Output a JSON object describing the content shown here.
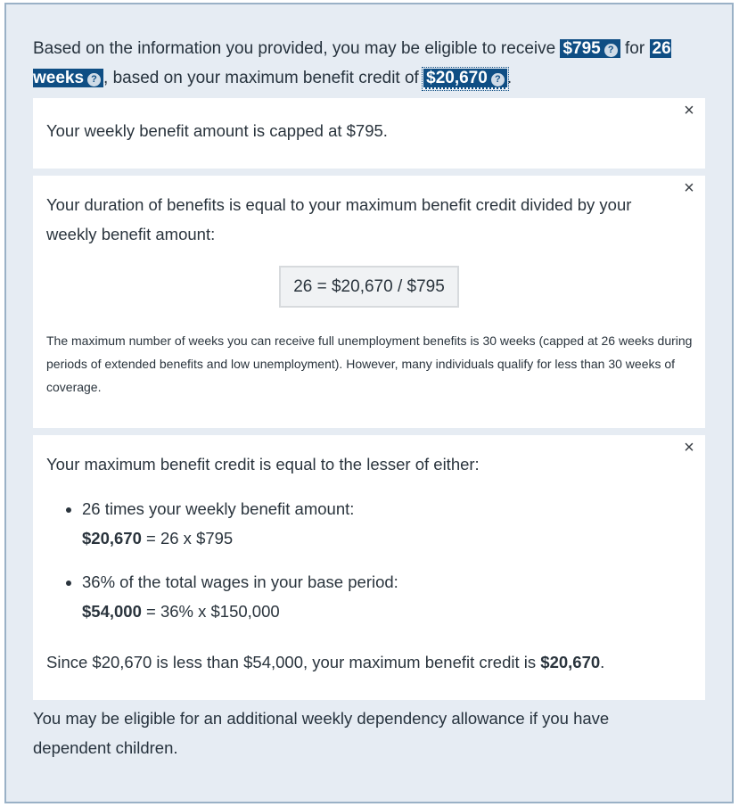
{
  "intro": {
    "prefix": "Based on the information you provided, you may be eligible to receive",
    "amount": "$795",
    "mid": "for",
    "duration": "26 weeks",
    "mid2": ", based on your maximum benefit credit of",
    "credit": "$20,670",
    "suffix": ".",
    "help_glyph": "?"
  },
  "card1": {
    "text": "Your weekly benefit amount is capped at $795.",
    "close_glyph": "×"
  },
  "card2": {
    "text": "Your duration of benefits is equal to your maximum benefit credit divided by your weekly benefit amount:",
    "formula": "26 = $20,670 / $795",
    "note": "The maximum number of weeks you can receive full unemployment benefits is 30 weeks (capped at 26 weeks during periods of extended benefits and low unemployment). However, many individuals qualify for less than 30 weeks of coverage.",
    "close_glyph": "×"
  },
  "card3": {
    "heading": "Your maximum benefit credit is equal to the lesser of either:",
    "items": [
      {
        "label": "26 times your weekly benefit amount:",
        "result": "$20,670",
        "expr": " = 26 x $795"
      },
      {
        "label": "36% of the total wages in your base period:",
        "result": "$54,000",
        "expr": " = 36% x $150,000"
      }
    ],
    "conclusion_prefix": "Since $20,670 is less than $54,000, your maximum benefit credit is",
    "conclusion_value": "$20,670",
    "conclusion_suffix": ".",
    "close_glyph": "×"
  },
  "footer": {
    "text": "You may be eligible for an additional weekly dependency allowance if you have dependent children."
  },
  "colors": {
    "panel_bg": "#e6ecf3",
    "panel_border": "#9ab1c6",
    "highlight": "#0f4e84"
  }
}
